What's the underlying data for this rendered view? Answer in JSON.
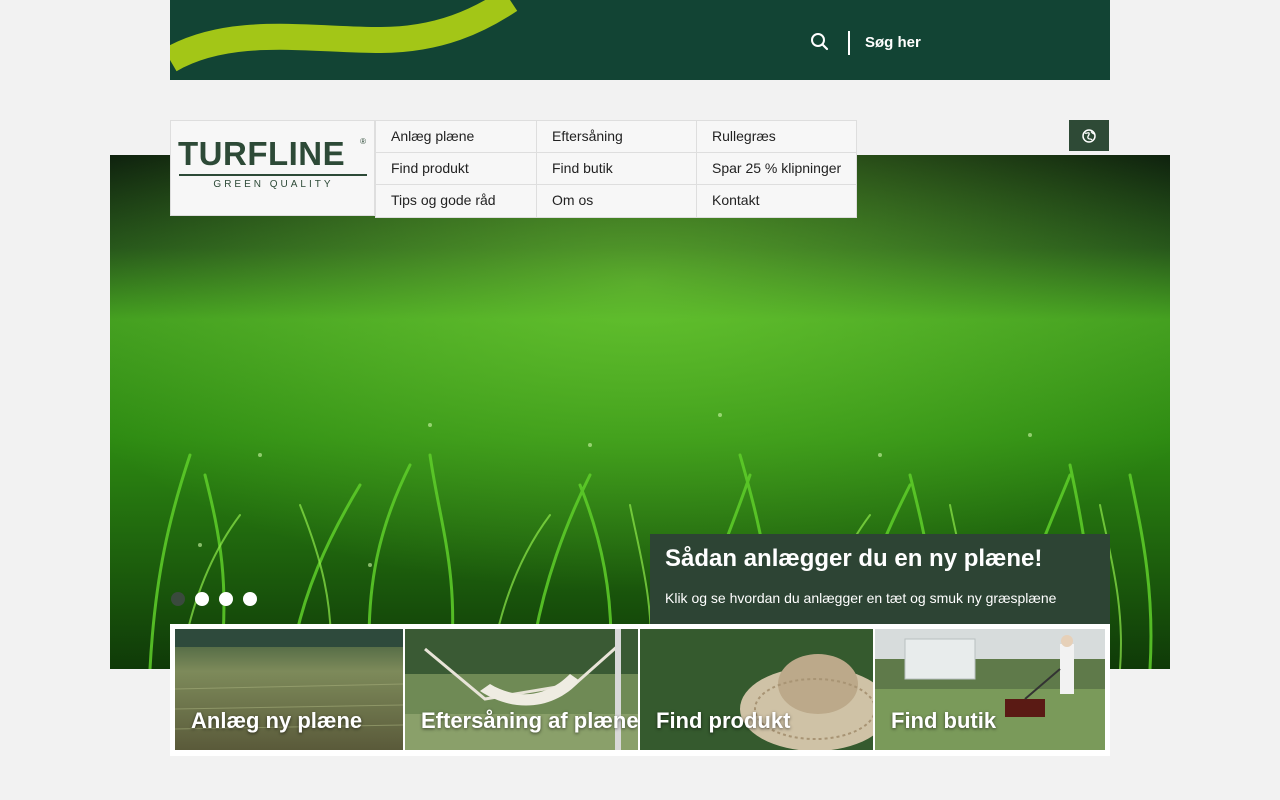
{
  "header": {
    "search_label": "Søg her",
    "search_icon": "magnifier",
    "background": "#124434",
    "accent": "#a3c617"
  },
  "logo": {
    "name": "TURFLINE",
    "registered": "®",
    "tagline": "GREEN QUALITY"
  },
  "nav": {
    "items": [
      "Anlæg plæne",
      "Eftersåning",
      "Rullegræs",
      "Find produkt",
      "Find butik",
      "Spar 25 % klipninger",
      "Tips og gode råd",
      "Om os",
      "Kontakt"
    ]
  },
  "language_button": {
    "icon": "globe"
  },
  "hero": {
    "title": "Sådan anlægger du en ny plæne!",
    "text": "Klik og se hvordan du anlægger en tæt og smuk ny græsplæne",
    "slides_total": 4,
    "active_slide": 1
  },
  "tiles": [
    {
      "label": "Anlæg ny plæne"
    },
    {
      "label": "Eftersåning af plæne"
    },
    {
      "label": "Find produkt"
    },
    {
      "label": "Find butik"
    }
  ]
}
